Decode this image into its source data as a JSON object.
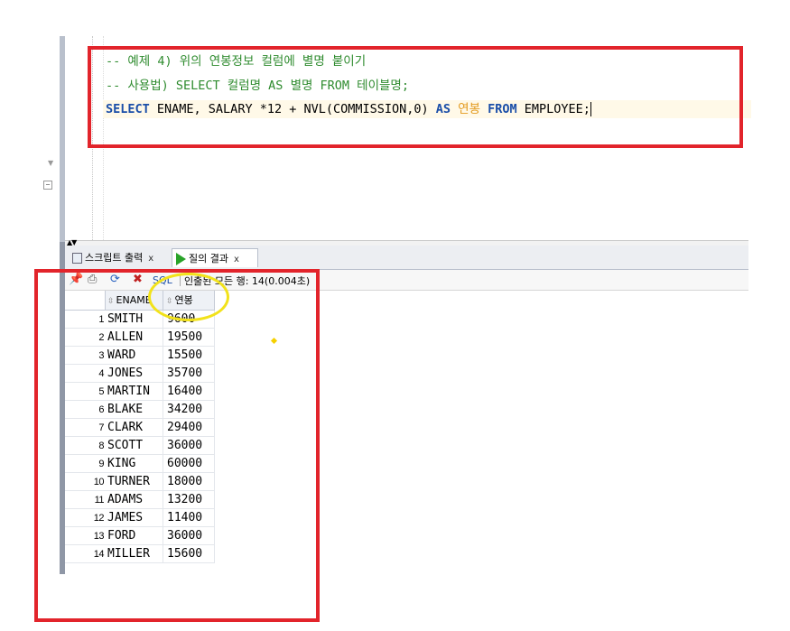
{
  "editor": {
    "lines": [
      {
        "segments": [
          {
            "cls": "cmt",
            "text": "-- 예제 4) 위의 연봉정보 컬럼에 별명 붙이기"
          }
        ]
      },
      {
        "segments": [
          {
            "cls": "cmt",
            "text": "-- 사용법) SELECT 컬럼명 AS 별명 FROM 테이블명;"
          }
        ]
      },
      {
        "segments": [
          {
            "cls": "kw",
            "text": "SELECT"
          },
          {
            "cls": "plain",
            "text": " ENAME, SALARY *12 + NVL(COMMISSION,0) "
          },
          {
            "cls": "kw",
            "text": "AS"
          },
          {
            "cls": "alias",
            "text": " 연봉 "
          },
          {
            "cls": "kw",
            "text": "FROM"
          },
          {
            "cls": "plain",
            "text": " EMPLOYEE;"
          }
        ]
      }
    ]
  },
  "tabs": {
    "script_output": {
      "label": "스크립트 출력",
      "close": "x"
    },
    "query_result": {
      "label": "질의 결과",
      "close": "x"
    }
  },
  "toolbar": {
    "sql_label": "SQL",
    "status": "인출된 모든 행: 14(0.004초)"
  },
  "grid": {
    "headers": {
      "ename": "ENAME",
      "salary": "연봉",
      "sort_glyph": "⇳"
    },
    "rows": [
      {
        "n": "1",
        "ename": "SMITH",
        "salary": "9600"
      },
      {
        "n": "2",
        "ename": "ALLEN",
        "salary": "19500"
      },
      {
        "n": "3",
        "ename": "WARD",
        "salary": "15500"
      },
      {
        "n": "4",
        "ename": "JONES",
        "salary": "35700"
      },
      {
        "n": "5",
        "ename": "MARTIN",
        "salary": "16400"
      },
      {
        "n": "6",
        "ename": "BLAKE",
        "salary": "34200"
      },
      {
        "n": "7",
        "ename": "CLARK",
        "salary": "29400"
      },
      {
        "n": "8",
        "ename": "SCOTT",
        "salary": "36000"
      },
      {
        "n": "9",
        "ename": "KING",
        "salary": "60000"
      },
      {
        "n": "10",
        "ename": "TURNER",
        "salary": "18000"
      },
      {
        "n": "11",
        "ename": "ADAMS",
        "salary": "13200"
      },
      {
        "n": "12",
        "ename": "JAMES",
        "salary": "11400"
      },
      {
        "n": "13",
        "ename": "FORD",
        "salary": "36000"
      },
      {
        "n": "14",
        "ename": "MILLER",
        "salary": "15600"
      }
    ]
  },
  "annotations": {
    "red_box_color": "#e2242b",
    "yellow_circle_color": "#f2e21a"
  }
}
